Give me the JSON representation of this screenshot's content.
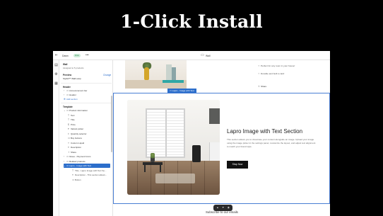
{
  "headline": "1-Click Install",
  "topbar": {
    "store_label": "Dawn",
    "live_badge": "Live",
    "more": "•••",
    "page_label": "Wall"
  },
  "sidebar": {
    "template_name": "Wall",
    "assigned": "Assigned to 5 products",
    "preview_label": "Preview",
    "preview_change": "Change",
    "preview_product": "Stylish™ Wall Lamp",
    "header_group": "Header",
    "header_items": [
      "Announcement bar",
      "Header"
    ],
    "add_section": "Add section",
    "template_group": "Template",
    "product_info": "Product information",
    "product_blocks": [
      "Text",
      "Title",
      "Price",
      "Variant picker",
      "Quantity selector",
      "Buy buttons",
      "Custom Liquid",
      "Description",
      "Share"
    ],
    "after_items": [
      "Gloue - Payment Icons",
      "Related products"
    ],
    "selected_section": "Lapro - Image with Text",
    "selected_children": [
      "Title - Lapro Image with Text Se...",
      "Description - This section allows...",
      "Button"
    ]
  },
  "canvas": {
    "prev_lines": [
      "Perfect for any room in your house!",
      "Durable and built to last!"
    ],
    "share": "Share",
    "section_tag": "Lapro - Image with Text",
    "section_title": "Lapro Image with Text Section",
    "section_body": "This section allows you to showcase your content alongside an image. Upload your image using the image picker in the settings panel, customize the layout, and adjust text alignment to match your brand style.",
    "section_button": "Shop Now",
    "subscribe": "Subscribe to our emails"
  },
  "colors": {
    "accent": "#2c6ecb",
    "live_badge_bg": "#cdeed9",
    "button_bg": "#111111"
  }
}
